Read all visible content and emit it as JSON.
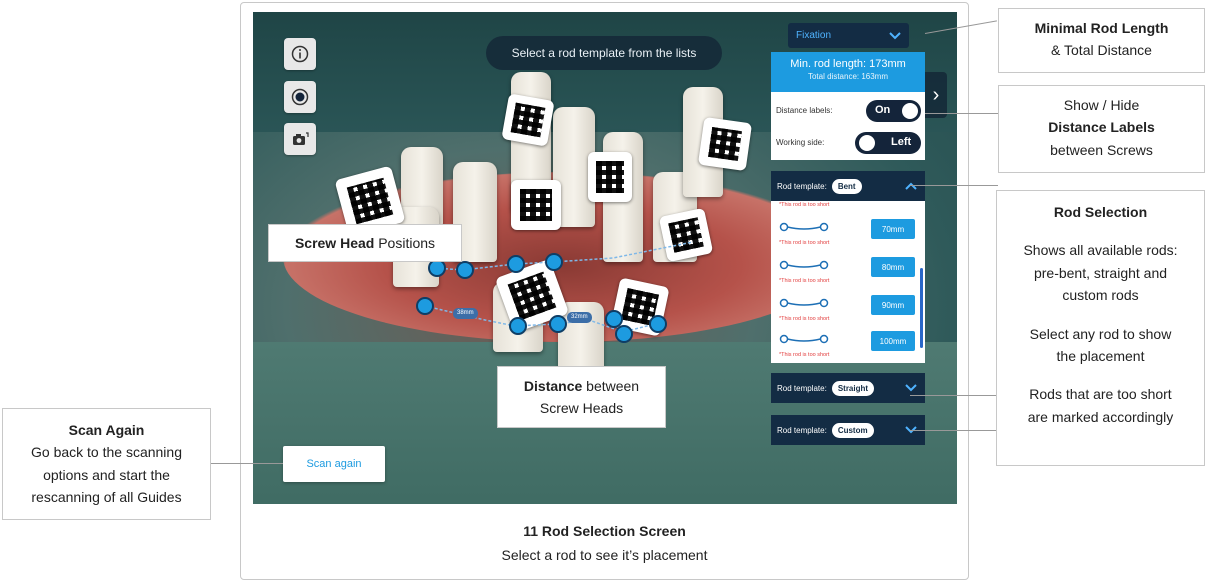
{
  "screen": {
    "top_hint": "Select a rod template from the lists",
    "dropdown": {
      "label": "Fixation",
      "chevron": "chevron-down-icon"
    },
    "min_rod": {
      "length_text": "Min. rod length: 173mm",
      "distance_text": "Total distance: 163mm"
    },
    "settings": {
      "distance_labels": {
        "label": "Distance labels:",
        "value": "On"
      },
      "working_side": {
        "label": "Working side:",
        "value": "Left"
      }
    },
    "rod_templates": [
      {
        "label": "Rod template:",
        "value": "Bent",
        "expanded": true
      },
      {
        "label": "Rod template:",
        "value": "Straight",
        "expanded": false
      },
      {
        "label": "Rod template:",
        "value": "Custom",
        "expanded": false
      }
    ],
    "rods": [
      {
        "size": "70mm",
        "warning": "*This rod is too short"
      },
      {
        "size": "80mm",
        "warning": "*This rod is too short"
      },
      {
        "size": "90mm",
        "warning": "*This rod is too short"
      },
      {
        "size": "100mm",
        "warning": "*This rod is too short"
      }
    ],
    "top_warning": "*This rod is too short",
    "distance_labels": [
      "38mm",
      "32mm"
    ],
    "scan_button": "Scan again",
    "side_arrow": "›"
  },
  "callouts": {
    "min_rod": {
      "title": "Minimal Rod Length",
      "subtitle": "& Total Distance"
    },
    "distance_labels": {
      "line1": "Show / Hide",
      "line2": "Distance Labels",
      "line3": "between Screws"
    },
    "rod_selection": {
      "title": "Rod Selection",
      "p1a": "Shows all available rods:",
      "p1b": "pre-bent, straight and",
      "p1c": "custom rods",
      "p2a": "Select any rod to show",
      "p2b": "the placement",
      "p3a": "Rods that are too short",
      "p3b": "are marked accordingly"
    },
    "scan_again": {
      "title": "Scan Again",
      "l1": "Go back to the scanning",
      "l2": "options and start the",
      "l3": "rescanning of all Guides"
    },
    "screw_head": {
      "bold": "Screw Head",
      "rest": " Positions"
    },
    "distance": {
      "bold": "Distance",
      "rest": " between",
      "line2": "Screw Heads"
    }
  },
  "caption": {
    "title": "11 Rod Selection Screen",
    "subtitle": "Select a rod to see it’s placement"
  },
  "colors": {
    "accent": "#1d9be0",
    "navy": "#132c44",
    "warning": "#e23c3c"
  }
}
